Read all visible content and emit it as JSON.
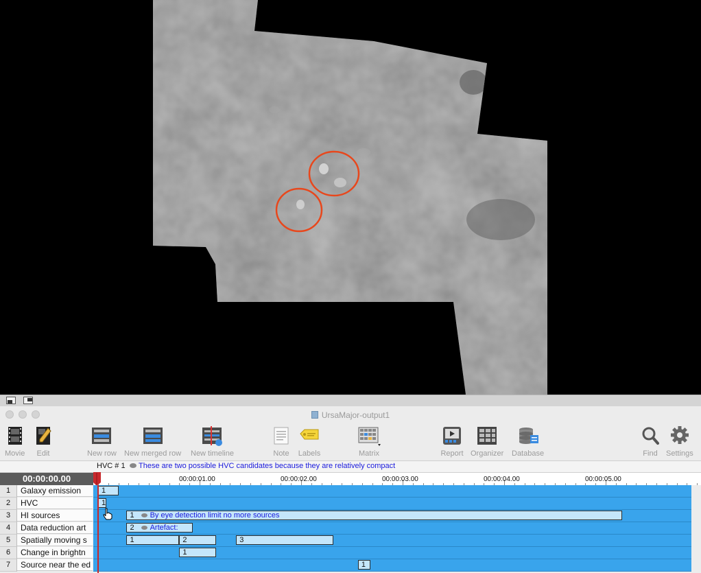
{
  "window": {
    "title": "UrsaMajor-output1"
  },
  "toolbar": {
    "movie": "Movie",
    "edit": "Edit",
    "new_row": "New row",
    "new_merged_row": "New merged row",
    "new_timeline": "New timeline",
    "note": "Note",
    "labels": "Labels",
    "matrix": "Matrix",
    "report": "Report",
    "organizer": "Organizer",
    "database": "Database",
    "find": "Find",
    "settings": "Settings"
  },
  "note": {
    "id": "HVC # 1",
    "text": "These are two possible HVC candidates because they are relatively compact"
  },
  "timeline": {
    "current_time": "00:00:00.00",
    "ticks": [
      "00:00:01.00",
      "00:00:02.00",
      "00:00:03.00",
      "00:00:04.00",
      "00:00:05.00"
    ]
  },
  "rows": [
    {
      "num": "1",
      "name": "Galaxy emission",
      "segments": [
        {
          "label": "1",
          "start": 0.0,
          "end": 0.2
        }
      ]
    },
    {
      "num": "2",
      "name": "HVC",
      "segments": [
        {
          "label": "1",
          "start": 0.0,
          "end": 0.08
        }
      ]
    },
    {
      "num": "3",
      "name": "HI sources",
      "segments": [
        {
          "label": "1",
          "comment": "By eye detection limit no more sources",
          "start": 0.28,
          "end": 5.16
        }
      ]
    },
    {
      "num": "4",
      "name": "Data reduction art",
      "segments": [
        {
          "label": "2",
          "comment": "Artefact:",
          "start": 0.28,
          "end": 0.93
        }
      ]
    },
    {
      "num": "5",
      "name": "Spatially moving s",
      "segments": [
        {
          "label": "1",
          "start": 0.28,
          "end": 0.8
        },
        {
          "label": "2",
          "start": 0.8,
          "end": 1.16
        },
        {
          "label": "3",
          "start": 1.36,
          "end": 2.32
        }
      ]
    },
    {
      "num": "6",
      "name": "Change in brightn",
      "segments": [
        {
          "label": "1",
          "start": 0.8,
          "end": 1.16
        }
      ]
    },
    {
      "num": "7",
      "name": "Source near the ed",
      "segments": [
        {
          "label": "1",
          "start": 2.56,
          "end": 2.68
        }
      ]
    }
  ],
  "colors": {
    "track": "#39a4ec",
    "segment": "#c4e6fb",
    "annotation_circle": "#e8471c",
    "playhead": "#c8282c",
    "note_text": "#1a1adc"
  },
  "icons": [
    "movie-icon",
    "edit-icon",
    "new-row-icon",
    "new-merged-row-icon",
    "new-timeline-icon",
    "note-icon",
    "labels-icon",
    "matrix-icon",
    "report-icon",
    "organizer-icon",
    "database-icon",
    "find-icon",
    "settings-icon"
  ]
}
